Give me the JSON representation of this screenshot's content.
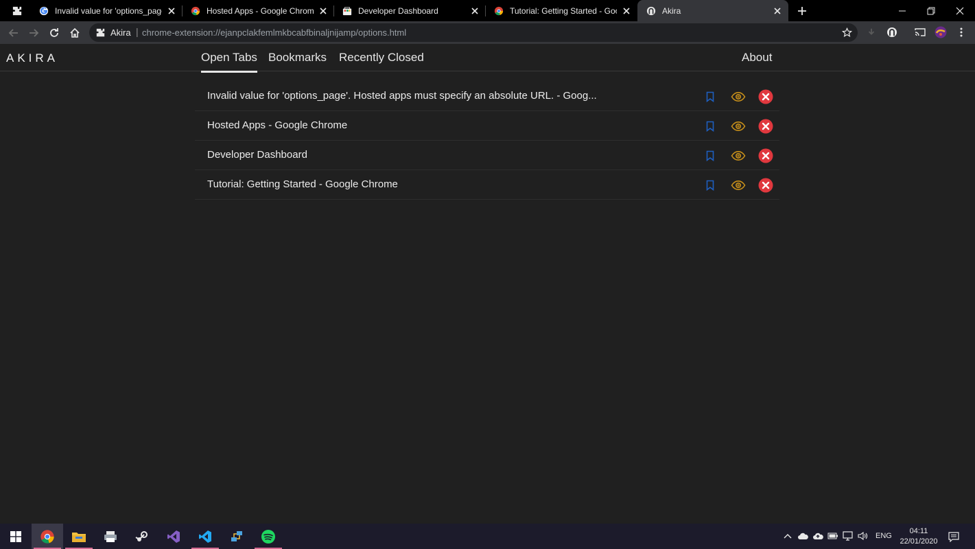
{
  "browser": {
    "tabs": [
      {
        "title": "Invalid value for 'options_page'. H",
        "favicon": "google-g-icon"
      },
      {
        "title": "Hosted Apps - Google Chrome",
        "favicon": "chrome-icon"
      },
      {
        "title": "Developer Dashboard",
        "favicon": "chrome-web-store-icon"
      },
      {
        "title": "Tutorial: Getting Started - Googl",
        "favicon": "chrome-icon"
      },
      {
        "title": "Akira",
        "favicon": "akira-icon"
      }
    ],
    "active_tab": 4,
    "omnibox": {
      "extension_name": "Akira",
      "separator": "|",
      "url": "chrome-extension://ejanpclakfemlmkbcabfbinaljnijamp/options.html"
    }
  },
  "app": {
    "brand": "AKIRA",
    "nav": [
      {
        "label": "Open Tabs",
        "active": true
      },
      {
        "label": "Bookmarks",
        "active": false
      },
      {
        "label": "Recently Closed",
        "active": false
      }
    ],
    "about": "About",
    "tabs_list": [
      {
        "title": "Invalid value for 'options_page'. Hosted apps must specify an absolute URL. - Goog..."
      },
      {
        "title": "Hosted Apps - Google Chrome"
      },
      {
        "title": "Developer Dashboard"
      },
      {
        "title": "Tutorial: Getting Started - Google Chrome"
      }
    ]
  },
  "taskbar": {
    "apps": [
      "windows-start-icon",
      "chrome-icon",
      "file-explorer-icon",
      "printer-icon",
      "steam-icon",
      "visual-studio-icon",
      "vscode-icon",
      "network-icon",
      "spotify-icon"
    ],
    "language": "ENG",
    "time": "04:11",
    "date": "22/01/2020"
  },
  "colors": {
    "bookmark": "#1e5fbf",
    "eye": "#c8901a",
    "close": "#e0383e",
    "page_bg": "#202020"
  }
}
